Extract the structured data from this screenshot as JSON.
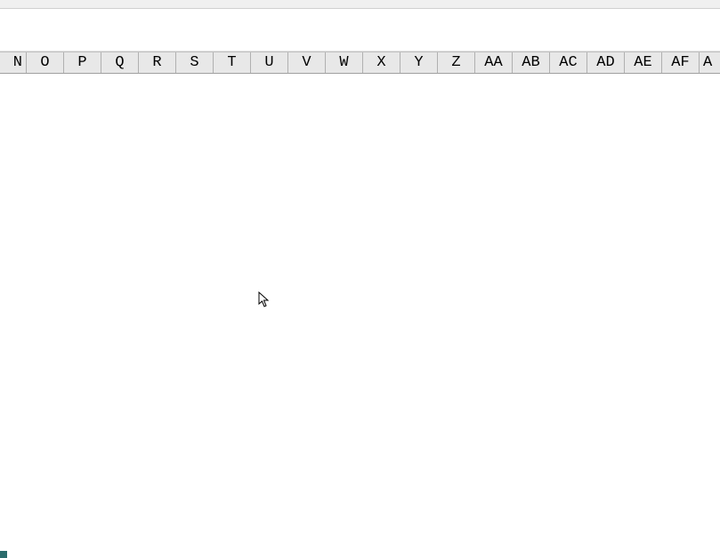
{
  "column_headers": {
    "partial_left": "N",
    "columns": [
      "O",
      "P",
      "Q",
      "R",
      "S",
      "T",
      "U",
      "V",
      "W",
      "X",
      "Y",
      "Z",
      "AA",
      "AB",
      "AC",
      "AD",
      "AE",
      "AF"
    ],
    "partial_right": "A"
  }
}
